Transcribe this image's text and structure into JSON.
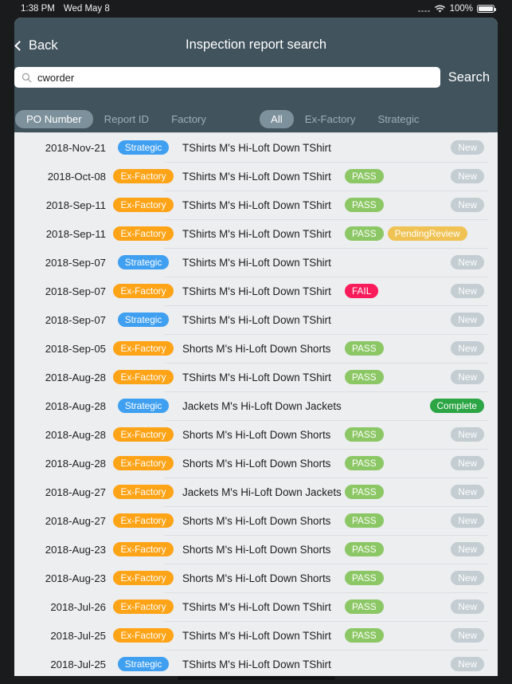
{
  "status_bar": {
    "time": "1:38 PM",
    "date": "Wed May 8",
    "battery_percent": "100%",
    "wifi_icon": "wifi-icon",
    "battery_icon": "battery-icon",
    "signal_icon": "signal-dots-icon"
  },
  "header": {
    "back_label": "Back",
    "back_icon": "chevron-left-icon",
    "title": "Inspection report search"
  },
  "search": {
    "icon": "search-icon",
    "value": "cworder",
    "placeholder": "",
    "button_label": "Search"
  },
  "filters": {
    "field_tabs": [
      {
        "label": "PO Number",
        "active": true
      },
      {
        "label": "Report ID",
        "active": false
      },
      {
        "label": "Factory",
        "active": false
      }
    ],
    "scope_tabs": [
      {
        "label": "All",
        "active": true
      },
      {
        "label": "Ex-Factory",
        "active": false
      },
      {
        "label": "Strategic",
        "active": false
      }
    ]
  },
  "colors": {
    "nav_background": "#41535d",
    "list_background": "#eceef0",
    "tab_active": "#7d919c",
    "strategic": "#3f9ff0",
    "ex_factory": "#ffa317",
    "pass": "#8cc765",
    "fail": "#fa1c5a",
    "pending_review": "#efc253",
    "new": "#c3cdd2",
    "complete": "#2ca544"
  },
  "rows": [
    {
      "date": "2018-Nov-21",
      "type": "Strategic",
      "type_class": "strategic",
      "name": "TShirts M's Hi-Loft Down TShirt",
      "results": [],
      "status": "New",
      "status_class": "new"
    },
    {
      "date": "2018-Oct-08",
      "type": "Ex-Factory",
      "type_class": "exfactory",
      "name": "TShirts M's Hi-Loft Down TShirt",
      "results": [
        {
          "label": "PASS",
          "cls": "pass"
        }
      ],
      "status": "New",
      "status_class": "new"
    },
    {
      "date": "2018-Sep-11",
      "type": "Ex-Factory",
      "type_class": "exfactory",
      "name": "TShirts M's Hi-Loft Down TShirt",
      "results": [
        {
          "label": "PASS",
          "cls": "pass"
        }
      ],
      "status": "New",
      "status_class": "new"
    },
    {
      "date": "2018-Sep-11",
      "type": "Ex-Factory",
      "type_class": "exfactory",
      "name": "TShirts M's Hi-Loft Down TShirt",
      "results": [
        {
          "label": "PASS",
          "cls": "pass"
        },
        {
          "label": "PendingReview",
          "cls": "pending"
        }
      ],
      "status": "",
      "status_class": ""
    },
    {
      "date": "2018-Sep-07",
      "type": "Strategic",
      "type_class": "strategic",
      "name": "TShirts M's Hi-Loft Down TShirt",
      "results": [],
      "status": "New",
      "status_class": "new"
    },
    {
      "date": "2018-Sep-07",
      "type": "Ex-Factory",
      "type_class": "exfactory",
      "name": "TShirts M's Hi-Loft Down TShirt",
      "results": [
        {
          "label": "FAIL",
          "cls": "fail"
        }
      ],
      "status": "New",
      "status_class": "new"
    },
    {
      "date": "2018-Sep-07",
      "type": "Strategic",
      "type_class": "strategic",
      "name": "TShirts M's Hi-Loft Down TShirt",
      "results": [],
      "status": "New",
      "status_class": "new"
    },
    {
      "date": "2018-Sep-05",
      "type": "Ex-Factory",
      "type_class": "exfactory",
      "name": "Shorts M's Hi-Loft Down Shorts",
      "results": [
        {
          "label": "PASS",
          "cls": "pass"
        }
      ],
      "status": "New",
      "status_class": "new"
    },
    {
      "date": "2018-Aug-28",
      "type": "Ex-Factory",
      "type_class": "exfactory",
      "name": "TShirts M's Hi-Loft Down TShirt",
      "results": [
        {
          "label": "PASS",
          "cls": "pass"
        }
      ],
      "status": "New",
      "status_class": "new"
    },
    {
      "date": "2018-Aug-28",
      "type": "Strategic",
      "type_class": "strategic",
      "name": "Jackets M's Hi-Loft Down Jackets",
      "results": [],
      "status": "Complete",
      "status_class": "complete"
    },
    {
      "date": "2018-Aug-28",
      "type": "Ex-Factory",
      "type_class": "exfactory",
      "name": "Shorts M's Hi-Loft Down Shorts",
      "results": [
        {
          "label": "PASS",
          "cls": "pass"
        }
      ],
      "status": "New",
      "status_class": "new"
    },
    {
      "date": "2018-Aug-28",
      "type": "Ex-Factory",
      "type_class": "exfactory",
      "name": "Shorts M's Hi-Loft Down Shorts",
      "results": [
        {
          "label": "PASS",
          "cls": "pass"
        }
      ],
      "status": "New",
      "status_class": "new"
    },
    {
      "date": "2018-Aug-27",
      "type": "Ex-Factory",
      "type_class": "exfactory",
      "name": "Jackets M's Hi-Loft Down Jackets",
      "results": [
        {
          "label": "PASS",
          "cls": "pass"
        }
      ],
      "status": "New",
      "status_class": "new"
    },
    {
      "date": "2018-Aug-27",
      "type": "Ex-Factory",
      "type_class": "exfactory",
      "name": "Shorts M's Hi-Loft Down Shorts",
      "results": [
        {
          "label": "PASS",
          "cls": "pass"
        }
      ],
      "status": "New",
      "status_class": "new"
    },
    {
      "date": "2018-Aug-23",
      "type": "Ex-Factory",
      "type_class": "exfactory",
      "name": "Shorts M's Hi-Loft Down Shorts",
      "results": [
        {
          "label": "PASS",
          "cls": "pass"
        }
      ],
      "status": "New",
      "status_class": "new"
    },
    {
      "date": "2018-Aug-23",
      "type": "Ex-Factory",
      "type_class": "exfactory",
      "name": "Shorts M's Hi-Loft Down Shorts",
      "results": [
        {
          "label": "PASS",
          "cls": "pass"
        }
      ],
      "status": "New",
      "status_class": "new"
    },
    {
      "date": "2018-Jul-26",
      "type": "Ex-Factory",
      "type_class": "exfactory",
      "name": "TShirts M's Hi-Loft Down TShirt",
      "results": [
        {
          "label": "PASS",
          "cls": "pass"
        }
      ],
      "status": "New",
      "status_class": "new"
    },
    {
      "date": "2018-Jul-25",
      "type": "Ex-Factory",
      "type_class": "exfactory",
      "name": "TShirts M's Hi-Loft Down TShirt",
      "results": [
        {
          "label": "PASS",
          "cls": "pass"
        }
      ],
      "status": "New",
      "status_class": "new"
    },
    {
      "date": "2018-Jul-25",
      "type": "Strategic",
      "type_class": "strategic",
      "name": "TShirts M's Hi-Loft Down TShirt",
      "results": [],
      "status": "New",
      "status_class": "new"
    }
  ]
}
